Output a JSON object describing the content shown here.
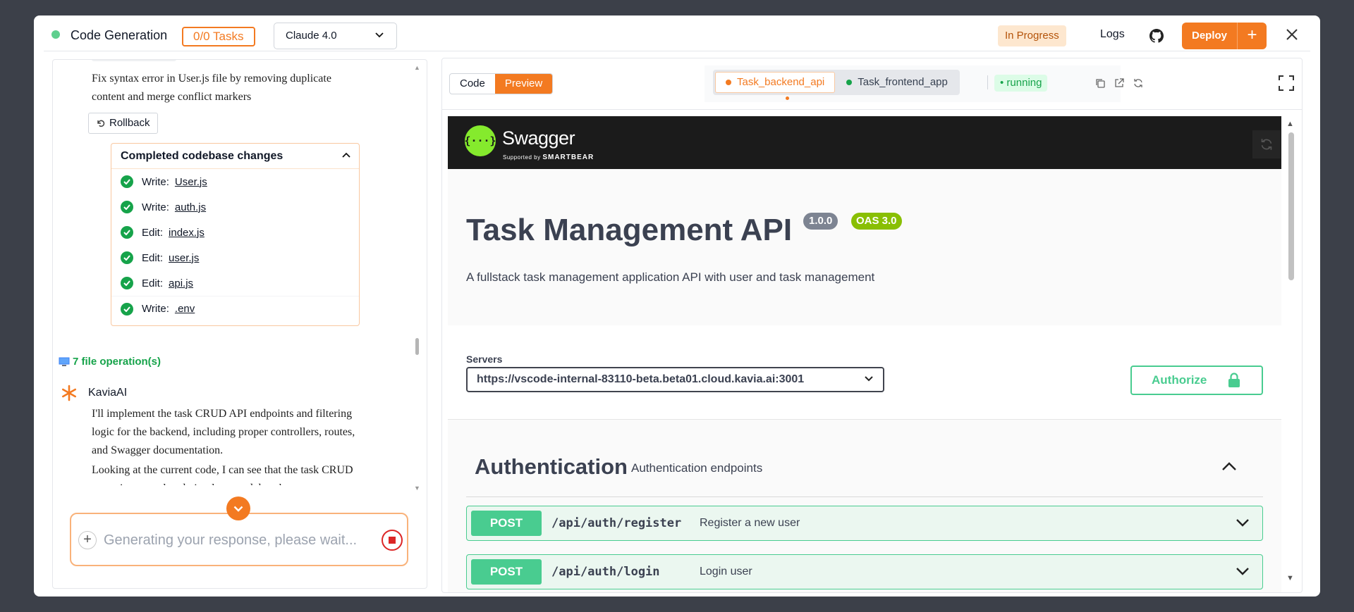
{
  "header": {
    "title": "Code Generation",
    "tasks_badge": "0/0 Tasks",
    "model": "Claude 4.0",
    "status": "In Progress",
    "logs_label": "Logs",
    "deploy_label": "Deploy",
    "deploy_plus": "+"
  },
  "chat": {
    "message1": "Fix syntax error in User.js file by removing duplicate content and merge conflict markers",
    "rollback_label": "Rollback",
    "changes_title": "Completed codebase changes",
    "changes": [
      {
        "action": "Write:",
        "file": "User.js"
      },
      {
        "action": "Write:",
        "file": "auth.js"
      },
      {
        "action": "Edit:",
        "file": "index.js"
      },
      {
        "action": "Edit:",
        "file": "user.js"
      },
      {
        "action": "Edit:",
        "file": "api.js"
      },
      {
        "action": "Write:",
        "file": ".env"
      }
    ],
    "file_ops": "7 file operation(s)",
    "agent_name": "KaviaAI",
    "message2": "I'll implement the task CRUD API endpoints and filtering logic for the backend, including proper controllers, routes, and Swagger documentation.",
    "message3": "Looking at the current code, I can see that the task CRUD operations are already implemented, but there",
    "input_placeholder": "Generating your response, please wait..."
  },
  "preview": {
    "code_tab": "Code",
    "preview_tab": "Preview",
    "task_tabs": [
      {
        "label": "Task_backend_api",
        "color": "#f37a21"
      },
      {
        "label": "Task_frontend_app",
        "color": "#16a34a"
      }
    ],
    "running_label": "• running"
  },
  "swagger": {
    "brand": "Swagger",
    "supported_by": "Supported by",
    "smartbear": "SMARTBEAR",
    "api_title": "Task Management API",
    "version": "1.0.0",
    "oas": "OAS 3.0",
    "description": "A fullstack task management application API with user and task management",
    "servers_label": "Servers",
    "server_url": "https://vscode-internal-83110-beta.beta01.cloud.kavia.ai:3001",
    "authorize_label": "Authorize",
    "section_title": "Authentication",
    "section_desc": "Authentication endpoints",
    "operations": [
      {
        "method": "POST",
        "path": "/api/auth/register",
        "summary": "Register a new user"
      },
      {
        "method": "POST",
        "path": "/api/auth/login",
        "summary": "Login user"
      }
    ]
  },
  "colors": {
    "accent": "#f37a21",
    "success": "#16a34a",
    "swagger_green": "#49cc90"
  }
}
